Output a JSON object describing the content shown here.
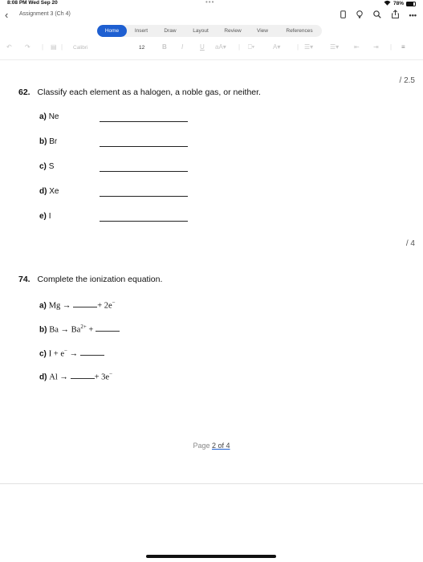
{
  "status": {
    "time": "8:08 PM  Wed Sep 20",
    "battery": "78%"
  },
  "app": {
    "document_title": "Assignment 3 (Ch 4)"
  },
  "ribbon": {
    "tabs": [
      "Home",
      "Insert",
      "Draw",
      "Layout",
      "Review",
      "View",
      "References"
    ],
    "active": "Home"
  },
  "toolbar": {
    "font": "Calibri",
    "size": "12"
  },
  "page": {
    "q62": {
      "score": "/ 2.5",
      "number": "62.",
      "prompt": "Classify each element as a halogen, a noble gas, or neither.",
      "items": [
        {
          "label": "a)",
          "text": "Ne"
        },
        {
          "label": "b)",
          "text": "Br"
        },
        {
          "label": "c)",
          "text": "S"
        },
        {
          "label": "d)",
          "text": "Xe"
        },
        {
          "label": "e)",
          "text": "I"
        }
      ]
    },
    "q74": {
      "score": "/ 4",
      "number": "74.",
      "prompt": "Complete the ionization equation.",
      "a": {
        "label": "a)",
        "lhs": "Mg →",
        "rhs": "+ 2e",
        "sup": "−"
      },
      "b": {
        "label": "b)",
        "lhs": "Ba  →  Ba",
        "sup": "2+",
        "rhs": " +"
      },
      "c": {
        "label": "c)",
        "lhs": "I +  e",
        "sup": "−",
        "rhs": "  →"
      },
      "d": {
        "label": "d)",
        "lhs": "Al →",
        "rhs": "+ 3e",
        "sup": "−"
      }
    },
    "footer": {
      "prefix": "Page ",
      "current": "2",
      "of": " of ",
      "total": "4"
    }
  }
}
